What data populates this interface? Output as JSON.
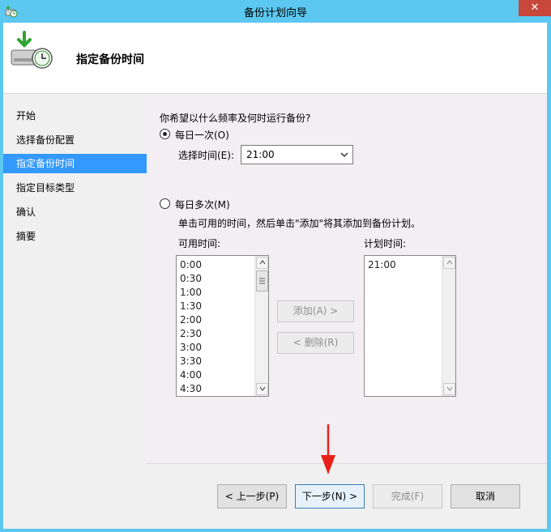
{
  "window": {
    "title": "备份计划向导",
    "close_glyph": "✕"
  },
  "header": {
    "title": "指定备份时间"
  },
  "sidebar": {
    "items": [
      {
        "label": "开始"
      },
      {
        "label": "选择备份配置"
      },
      {
        "label": "指定备份时间",
        "active": true
      },
      {
        "label": "指定目标类型"
      },
      {
        "label": "确认"
      },
      {
        "label": "摘要"
      }
    ]
  },
  "content": {
    "question": "你希望以什么频率及何时运行备份?",
    "once_daily": {
      "label": "每日一次(O)",
      "checked": true
    },
    "select_time": {
      "label": "选择时间(E):",
      "value": "21:00"
    },
    "multiple_daily": {
      "label": "每日多次(M)",
      "checked": false
    },
    "hint": "单击可用的时间，然后单击\"添加\"将其添加到备份计划。",
    "available": {
      "label": "可用时间:",
      "items": [
        "0:00",
        "0:30",
        "1:00",
        "1:30",
        "2:00",
        "2:30",
        "3:00",
        "3:30",
        "4:00",
        "4:30"
      ]
    },
    "scheduled": {
      "label": "计划时间:",
      "items": [
        "21:00"
      ]
    },
    "add_button": "添加(A) >",
    "remove_button": "< 删除(R)"
  },
  "footer": {
    "prev_button": "< 上一步(P)",
    "next_button": "下一步(N) >",
    "finish_button": "完成(F)",
    "cancel_button": "取消"
  },
  "colors": {
    "titlebar": "#5cc8f0",
    "active_nav": "#3399ff",
    "close": "#c7473a",
    "arrow": "#e8221b"
  }
}
